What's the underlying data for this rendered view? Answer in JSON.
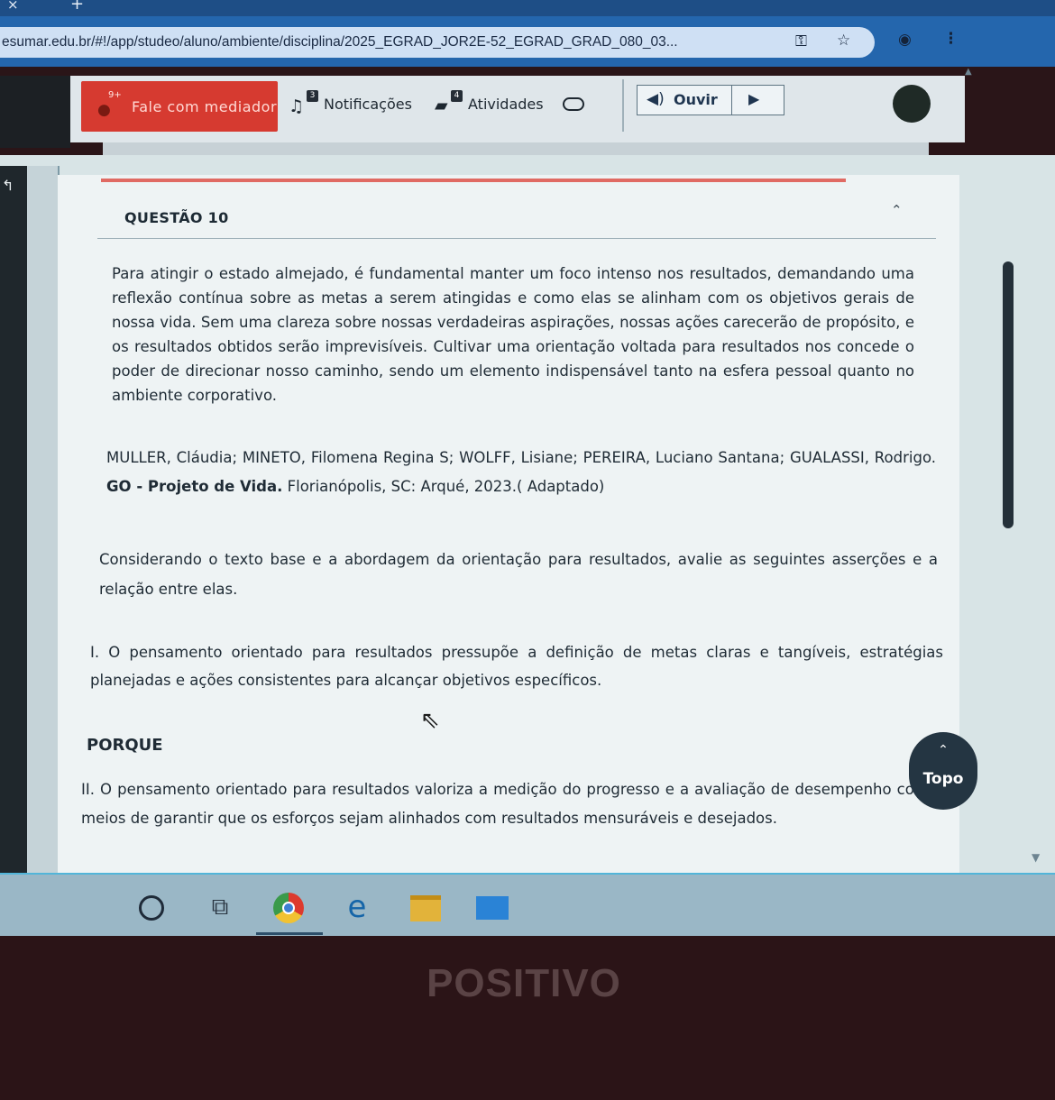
{
  "browser": {
    "url": "esumar.edu.br/#!/app/studeo/aluno/ambiente/disciplina/2025_EGRAD_JOR2E-52_EGRAD_GRAD_080_03..."
  },
  "toolbar": {
    "mediador_label": "Fale com mediador",
    "mediador_count": "9+",
    "notificacoes_label": "Notificações",
    "notificacoes_badge": "3",
    "atividades_label": "Atividades",
    "atividades_badge": "4",
    "ouvir_label": "Ouvir"
  },
  "question": {
    "title": "QUESTÃO 10",
    "paragraph": "Para atingir o estado almejado, é fundamental manter um foco intenso nos resultados, demandando uma reflexão contínua sobre as metas a serem atingidas e como elas se alinham com os objetivos gerais de nossa vida. Sem uma clareza sobre nossas verdadeiras aspirações, nossas ações carecerão de propósito, e os resultados obtidos serão imprevisíveis. Cultivar uma orientação voltada para resultados nos concede o poder de direcionar nosso caminho, sendo um elemento indispensável tanto na esfera pessoal quanto no ambiente corporativo.",
    "reference_authors": "MULLER, Cláudia; MINETO, Filomena Regina S; WOLFF, Lisiane; PEREIRA, Luciano Santana; GUALASSI, Rodrigo.",
    "reference_title": "GO - Projeto de Vida.",
    "reference_rest": " Florianópolis, SC: Arqué, 2023.( Adaptado)",
    "instruction": "Considerando o texto base e a abordagem da orientação para resultados, avalie as seguintes asserções e a relação entre elas.",
    "assertion_1": "I. O pensamento orientado para resultados pressupõe a definição de metas claras e tangíveis, estratégias planejadas e ações consistentes para alcançar objetivos específicos.",
    "connector": "PORQUE",
    "assertion_2": "II. O pensamento orientado para resultados valoriza a medição do progresso e a avaliação de desempenho como meios de garantir que os esforços sejam alinhados com resultados mensuráveis e desejados."
  },
  "topo_button": {
    "label": "Topo"
  },
  "bezel": {
    "brand": "POSITIVO"
  }
}
